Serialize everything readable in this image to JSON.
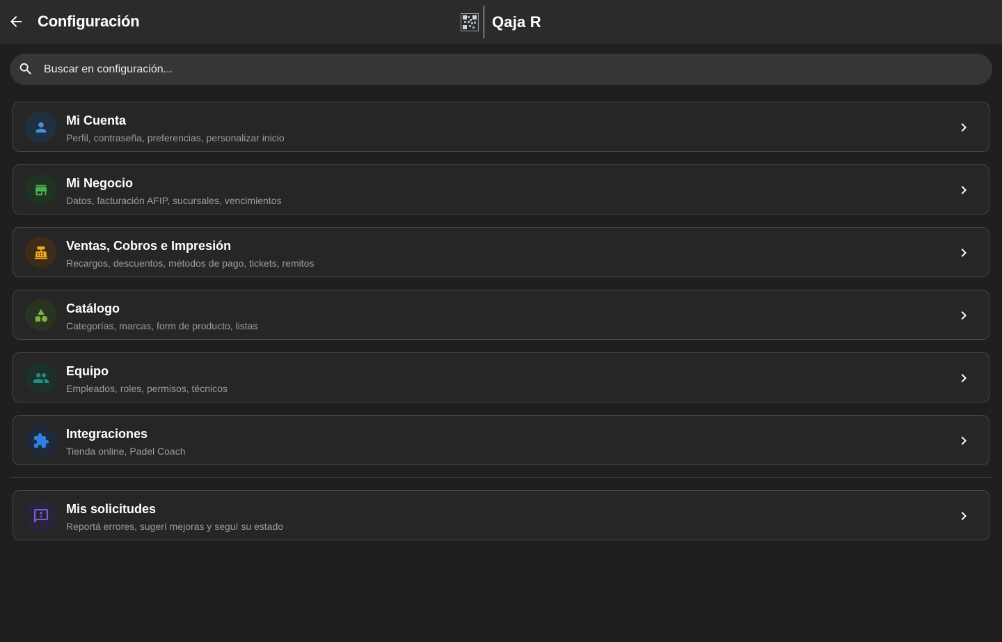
{
  "header": {
    "title": "Configuración",
    "brand_name": "Qaja R"
  },
  "search": {
    "placeholder": "Buscar en configuración...",
    "value": ""
  },
  "items": [
    {
      "title": "Mi Cuenta",
      "subtitle": "Perfil, contraseña, preferencias, personalizar inicio",
      "icon": "person-icon",
      "color": "#4a90e2",
      "bg": "#1f3041"
    },
    {
      "title": "Mi Negocio",
      "subtitle": "Datos, facturación AFIP, sucursales, vencimientos",
      "icon": "store-icon",
      "color": "#4caf50",
      "bg": "#1e3322"
    },
    {
      "title": "Ventas, Cobros e Impresión",
      "subtitle": "Recargos, descuentos, métodos de pago, tickets, remitos",
      "icon": "cash-register-icon",
      "color": "#f5a623",
      "bg": "#3d2c17"
    },
    {
      "title": "Catálogo",
      "subtitle": "Categorías, marcas, form de producto, listas",
      "icon": "category-icon",
      "color": "#7cb342",
      "bg": "#293320"
    },
    {
      "title": "Equipo",
      "subtitle": "Empleados, roles, permisos, técnicos",
      "icon": "people-icon",
      "color": "#1f8f80",
      "bg": "#1c302d"
    },
    {
      "title": "Integraciones",
      "subtitle": "Tienda online, Padel Coach",
      "icon": "puzzle-icon",
      "color": "#2f7fe0",
      "bg": "#1d2a3e"
    }
  ],
  "requests_item": {
    "title": "Mis solicitudes",
    "subtitle": "Reportá errores, sugerí mejoras y seguí su estado",
    "icon": "feedback-icon",
    "color": "#7e5fe0",
    "bg": "#2a2438"
  }
}
